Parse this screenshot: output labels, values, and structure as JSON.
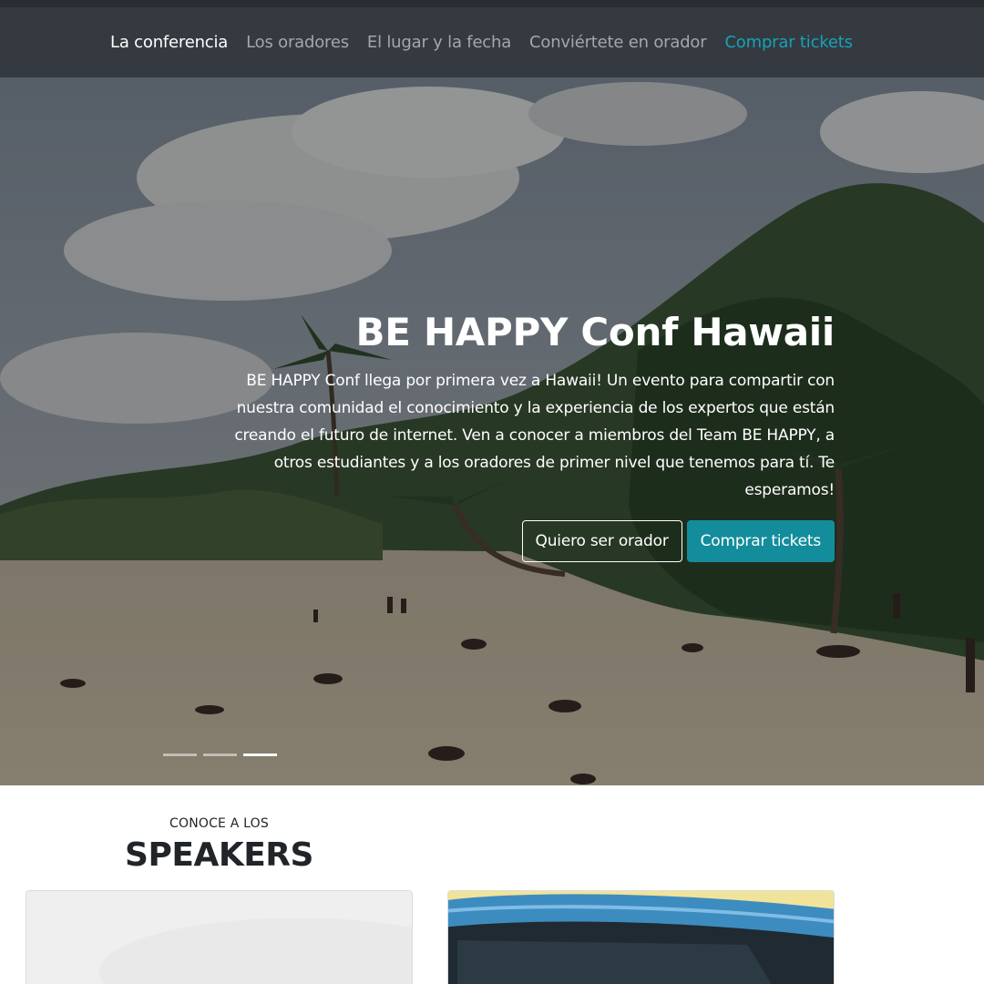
{
  "nav": {
    "items": [
      {
        "label": "La conferencia"
      },
      {
        "label": "Los oradores"
      },
      {
        "label": "El lugar y la fecha"
      },
      {
        "label": "Conviértete en orador"
      },
      {
        "label": "Comprar tickets"
      }
    ]
  },
  "hero": {
    "title": "BE HAPPY Conf Hawaii",
    "text": "BE HAPPY Conf llega por primera vez a Hawaii! Un evento para compartir con nuestra comunidad el conocimiento y la experiencia de los expertos que están creando el futuro de internet. Ven a conocer a miembros del Team BE HAPPY, a otros estudiantes y a los oradores de primer nivel que tenemos para tí. Te esperamos!",
    "buttons": {
      "speaker": "Quiero ser orador",
      "tickets": "Comprar tickets"
    },
    "carousel": {
      "slides": 3,
      "active": 3
    }
  },
  "speakers": {
    "subtitle": "CONOCE A LOS",
    "title": "SPEAKERS"
  },
  "colors": {
    "navbar": "#343a40",
    "accent": "#17a2b8",
    "button_teal": "#138d9c"
  }
}
